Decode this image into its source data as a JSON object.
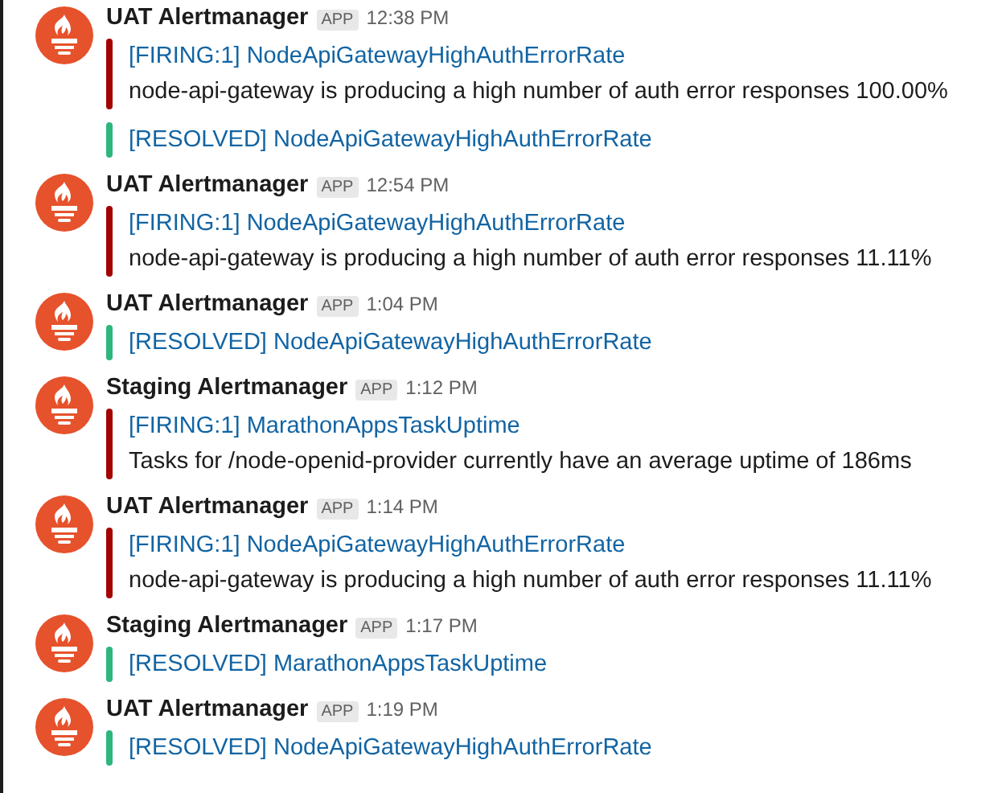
{
  "messages": [
    {
      "sender": "UAT Alertmanager",
      "badge": "APP",
      "time": "12:38 PM",
      "attachments": [
        {
          "color": "#a30200",
          "title": "[FIRING:1] NodeApiGatewayHighAuthErrorRate",
          "text": "node-api-gateway is producing a high number of auth error responses 100.00%"
        },
        {
          "color": "#2eb67d",
          "title": "[RESOLVED] NodeApiGatewayHighAuthErrorRate"
        }
      ]
    },
    {
      "sender": "UAT Alertmanager",
      "badge": "APP",
      "time": "12:54 PM",
      "attachments": [
        {
          "color": "#a30200",
          "title": "[FIRING:1] NodeApiGatewayHighAuthErrorRate",
          "text": "node-api-gateway is producing a high number of auth error responses 11.11%"
        }
      ]
    },
    {
      "sender": "UAT Alertmanager",
      "badge": "APP",
      "time": "1:04 PM",
      "attachments": [
        {
          "color": "#2eb67d",
          "title": "[RESOLVED] NodeApiGatewayHighAuthErrorRate"
        }
      ]
    },
    {
      "sender": "Staging Alertmanager",
      "badge": "APP",
      "time": "1:12 PM",
      "attachments": [
        {
          "color": "#a30200",
          "title": "[FIRING:1] MarathonAppsTaskUptime",
          "text": "Tasks for /node-openid-provider currently have an average uptime of 186ms"
        }
      ]
    },
    {
      "sender": "UAT Alertmanager",
      "badge": "APP",
      "time": "1:14 PM",
      "attachments": [
        {
          "color": "#a30200",
          "title": "[FIRING:1] NodeApiGatewayHighAuthErrorRate",
          "text": "node-api-gateway is producing a high number of auth error responses 11.11%"
        }
      ]
    },
    {
      "sender": "Staging Alertmanager",
      "badge": "APP",
      "time": "1:17 PM",
      "attachments": [
        {
          "color": "#2eb67d",
          "title": "[RESOLVED] MarathonAppsTaskUptime"
        }
      ]
    },
    {
      "sender": "UAT Alertmanager",
      "badge": "APP",
      "time": "1:19 PM",
      "attachments": [
        {
          "color": "#2eb67d",
          "title": "[RESOLVED] NodeApiGatewayHighAuthErrorRate"
        }
      ]
    }
  ]
}
